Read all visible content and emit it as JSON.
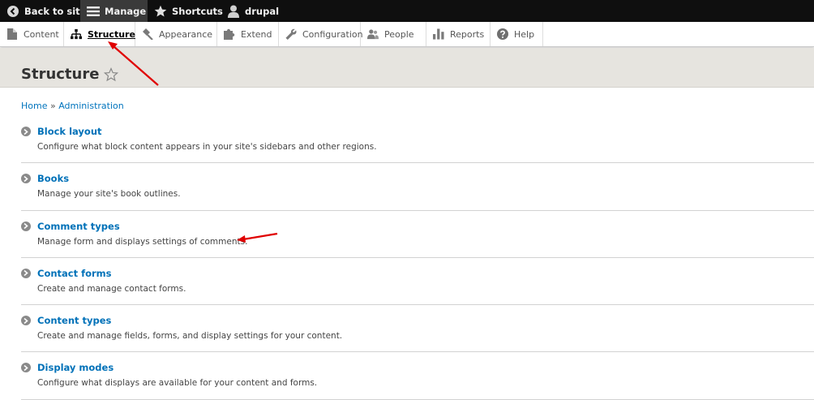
{
  "toolbar": {
    "back_label": "Back to site",
    "manage_label": "Manage",
    "shortcuts_label": "Shortcuts",
    "user_label": "drupal"
  },
  "tray": {
    "items": [
      {
        "label": "Content",
        "icon": "page-icon"
      },
      {
        "label": "Structure",
        "icon": "sitemap-icon"
      },
      {
        "label": "Appearance",
        "icon": "paintbrush-icon"
      },
      {
        "label": "Extend",
        "icon": "puzzle-icon"
      },
      {
        "label": "Configuration",
        "icon": "wrench-icon"
      },
      {
        "label": "People",
        "icon": "people-icon"
      },
      {
        "label": "Reports",
        "icon": "bar-chart-icon"
      },
      {
        "label": "Help",
        "icon": "question-icon"
      }
    ],
    "active": "Structure"
  },
  "page": {
    "title": "Structure"
  },
  "breadcrumb": {
    "home": "Home",
    "separator": "»",
    "administration": "Administration"
  },
  "admin_list": [
    {
      "title": "Block layout",
      "description": "Configure what block content appears in your site's sidebars and other regions."
    },
    {
      "title": "Books",
      "description": "Manage your site's book outlines."
    },
    {
      "title": "Comment types",
      "description": "Manage form and displays settings of comments."
    },
    {
      "title": "Contact forms",
      "description": "Create and manage contact forms."
    },
    {
      "title": "Content types",
      "description": "Create and manage fields, forms, and display settings for your content."
    },
    {
      "title": "Display modes",
      "description": "Configure what displays are available for your content and forms."
    }
  ],
  "colors": {
    "toolbar_bg": "#0f0f0f",
    "link": "#0071b8",
    "header_bg": "#e6e4df",
    "annotation": "#e00000"
  }
}
